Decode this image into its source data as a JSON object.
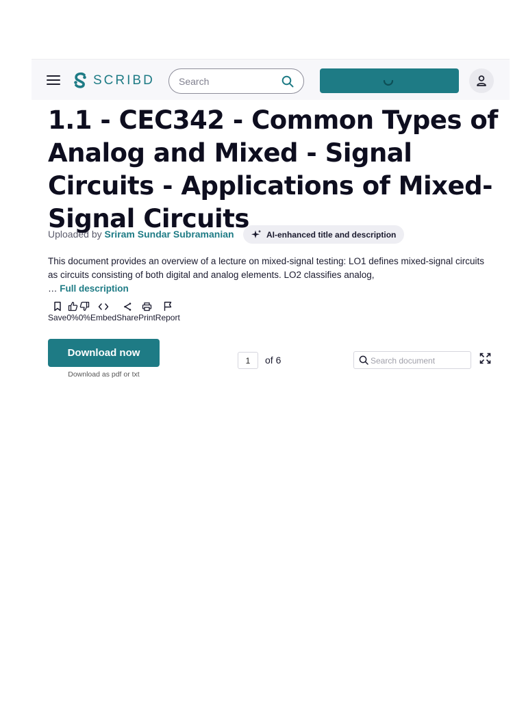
{
  "header": {
    "logo_text": "SCRIBD",
    "search": {
      "placeholder": "Search",
      "value": ""
    },
    "cta_state": "loading",
    "brand_color": "#1e7b85"
  },
  "document": {
    "title": "1.1 - CEC342 - Common Types of Analog and Mixed - Signal Circuits - Applications of Mixed-Signal Circuits",
    "uploaded_prefix": "Uploaded by",
    "author": "Sriram Sundar Subramanian",
    "ai_badge": "AI-enhanced title and description",
    "description": "This document provides an overview of a lecture on mixed-signal testing: LO1 defines mixed-signal circuits as circuits consisting of both digital and analog elements. LO2 classifies analog,",
    "ellipsis": "…",
    "full_description_link": "Full description"
  },
  "actions": [
    {
      "label": "Save",
      "icon": "bookmark-icon"
    },
    {
      "label": "0%",
      "icon": "thumbs-up-icon"
    },
    {
      "label": "0%",
      "icon": "thumbs-down-icon"
    },
    {
      "label": "Embed",
      "icon": "code-icon"
    },
    {
      "label": "Share",
      "icon": "share-icon"
    },
    {
      "label": "Print",
      "icon": "print-icon"
    },
    {
      "label": "Report",
      "icon": "flag-icon"
    }
  ],
  "download": {
    "button_label": "Download now",
    "sub_label": "Download as pdf or txt"
  },
  "viewer": {
    "current_page": "1",
    "page_total_label": "of 6",
    "search_placeholder": "Search document"
  }
}
